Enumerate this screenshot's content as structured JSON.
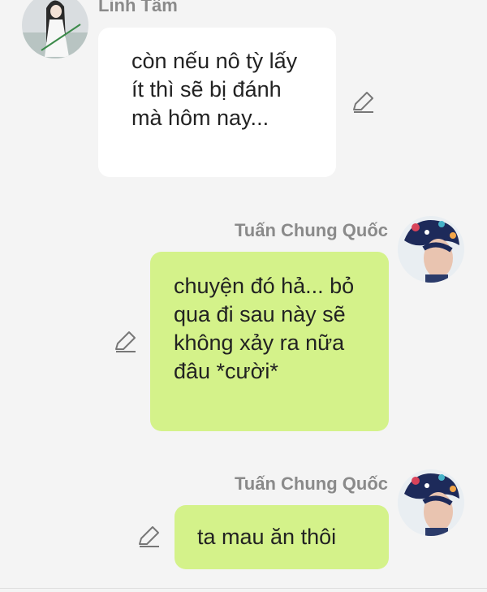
{
  "messages": [
    {
      "sender": "Linh Tâm",
      "side": "left",
      "text": "còn nếu nô tỳ lấy ít thì sẽ bị đánh mà hôm nay...",
      "avatar_icon": "woman-portrait-avatar"
    },
    {
      "sender": "Tuấn Chung Quốc",
      "side": "right",
      "text": "chuyện đó hả... bỏ qua đi sau này sẽ không xảy ra nữa đâu *cười*",
      "avatar_icon": "man-portrait-avatar"
    },
    {
      "sender": "Tuấn Chung Quốc",
      "side": "right",
      "text": "ta mau ăn thôi",
      "avatar_icon": "man-portrait-avatar"
    }
  ],
  "icons": {
    "edit": "pencil-icon"
  },
  "colors": {
    "background": "#f4f4f4",
    "left_bubble": "#ffffff",
    "right_bubble": "#d4f28a",
    "sender_name": "#8a8a8a"
  }
}
